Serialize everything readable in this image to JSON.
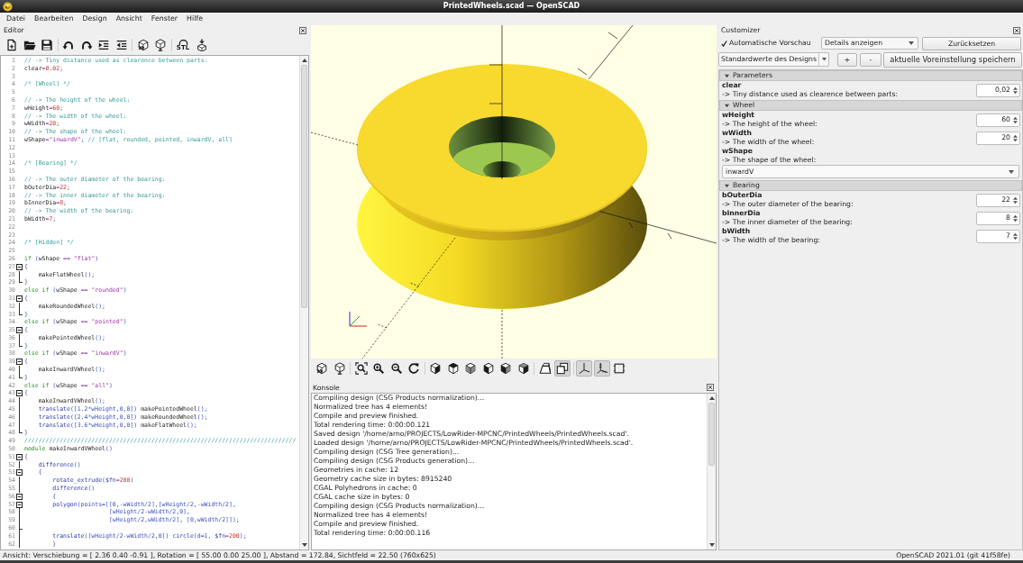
{
  "window": {
    "title": "PrintedWheels.scad — OpenSCAD"
  },
  "menu": [
    "Datei",
    "Bearbeiten",
    "Design",
    "Ansicht",
    "Fenster",
    "Hilfe"
  ],
  "editor": {
    "title": "Editor",
    "toolbar": [
      [
        {
          "kind": "new"
        },
        {
          "kind": "open"
        },
        {
          "kind": "save"
        }
      ],
      [
        {
          "kind": "undo"
        },
        {
          "kind": "redo"
        },
        {
          "kind": "indent"
        },
        {
          "kind": "unindent"
        }
      ],
      [
        {
          "kind": "preview"
        },
        {
          "kind": "render"
        }
      ],
      [
        {
          "kind": "export_stl",
          "label": "STL"
        },
        {
          "kind": "send_to_print"
        }
      ]
    ],
    "lines": [
      {
        "number": "1",
        "tokens": [
          {
            "kind": "comment",
            "text": "// -> Tiny distance used as clearence between parts:"
          }
        ]
      },
      {
        "number": "2",
        "tokens": [
          {
            "kind": "plain",
            "text": "clear"
          },
          {
            "kind": "operator",
            "text": "="
          },
          {
            "kind": "number",
            "text": "0.02"
          },
          {
            "kind": "punct",
            "text": ";"
          }
        ]
      },
      {
        "number": "3"
      },
      {
        "number": "4",
        "tokens": [
          {
            "kind": "comment",
            "text": "/* [Wheel] */"
          }
        ]
      },
      {
        "number": "5"
      },
      {
        "number": "6",
        "tokens": [
          {
            "kind": "comment",
            "text": "// -> The height of the wheel:"
          }
        ]
      },
      {
        "number": "7",
        "tokens": [
          {
            "kind": "plain",
            "text": "wHeight"
          },
          {
            "kind": "operator",
            "text": "="
          },
          {
            "kind": "number",
            "text": "60"
          },
          {
            "kind": "punct",
            "text": ";"
          }
        ]
      },
      {
        "number": "8",
        "tokens": [
          {
            "kind": "comment",
            "text": "// -> The width of the wheel:"
          }
        ]
      },
      {
        "number": "9",
        "tokens": [
          {
            "kind": "plain",
            "text": "wWidth"
          },
          {
            "kind": "operator",
            "text": "="
          },
          {
            "kind": "number",
            "text": "20"
          },
          {
            "kind": "punct",
            "text": ";"
          }
        ]
      },
      {
        "number": "10",
        "tokens": [
          {
            "kind": "comment",
            "text": "// -> The shape of the wheel:"
          }
        ]
      },
      {
        "number": "11",
        "tokens": [
          {
            "kind": "plain",
            "text": "wShape"
          },
          {
            "kind": "operator",
            "text": "="
          },
          {
            "kind": "string",
            "text": "\"inwardV\""
          },
          {
            "kind": "punct",
            "text": "; "
          },
          {
            "kind": "comment",
            "text": "// [flat, rounded, pointed, inwardV, all]"
          }
        ]
      },
      {
        "number": "12"
      },
      {
        "number": "13"
      },
      {
        "number": "14",
        "tokens": [
          {
            "kind": "comment",
            "text": "/* [Bearing] */"
          }
        ]
      },
      {
        "number": "15"
      },
      {
        "number": "16",
        "tokens": [
          {
            "kind": "comment",
            "text": "// -> The outer diameter of the bearing:"
          }
        ]
      },
      {
        "number": "17",
        "tokens": [
          {
            "kind": "plain",
            "text": "bOuterDia"
          },
          {
            "kind": "operator",
            "text": "="
          },
          {
            "kind": "number",
            "text": "22"
          },
          {
            "kind": "punct",
            "text": ";"
          }
        ]
      },
      {
        "number": "18",
        "tokens": [
          {
            "kind": "comment",
            "text": "// -> The inner diameter of the bearing:"
          }
        ]
      },
      {
        "number": "19",
        "tokens": [
          {
            "kind": "plain",
            "text": "bInnerDia"
          },
          {
            "kind": "operator",
            "text": "="
          },
          {
            "kind": "number",
            "text": "8"
          },
          {
            "kind": "punct",
            "text": ";"
          }
        ]
      },
      {
        "number": "20",
        "tokens": [
          {
            "kind": "comment",
            "text": "// -> The width of the bearing:"
          }
        ]
      },
      {
        "number": "21",
        "tokens": [
          {
            "kind": "plain",
            "text": "bWidth"
          },
          {
            "kind": "operator",
            "text": "="
          },
          {
            "kind": "number",
            "text": "7"
          },
          {
            "kind": "punct",
            "text": ";"
          }
        ]
      },
      {
        "number": "22"
      },
      {
        "number": "23"
      },
      {
        "number": "24",
        "tokens": [
          {
            "kind": "comment",
            "text": "/* [Hidden] */"
          }
        ]
      },
      {
        "number": "25"
      },
      {
        "number": "26",
        "tokens": [
          {
            "kind": "keyword",
            "text": "if "
          },
          {
            "kind": "punct",
            "text": "("
          },
          {
            "kind": "plain",
            "text": "wShape "
          },
          {
            "kind": "operator",
            "text": "== "
          },
          {
            "kind": "string",
            "text": "\"flat\""
          },
          {
            "kind": "punct",
            "text": ")"
          }
        ]
      },
      {
        "number": "27",
        "fold": {
          "kind": "open"
        },
        "tokens": [
          {
            "kind": "punct",
            "text": "{"
          }
        ]
      },
      {
        "number": "28",
        "fold": {
          "kind": "line"
        },
        "tokens": [
          {
            "kind": "plain",
            "text": "    makeFlatWheel"
          },
          {
            "kind": "punct",
            "text": "();"
          }
        ]
      },
      {
        "number": "29",
        "fold": {
          "kind": "end"
        },
        "tokens": [
          {
            "kind": "punct",
            "text": "}"
          }
        ]
      },
      {
        "number": "30",
        "tokens": [
          {
            "kind": "keyword",
            "text": "else if "
          },
          {
            "kind": "punct",
            "text": "("
          },
          {
            "kind": "plain",
            "text": "wShape "
          },
          {
            "kind": "operator",
            "text": "== "
          },
          {
            "kind": "string",
            "text": "\"rounded\""
          },
          {
            "kind": "punct",
            "text": ")"
          }
        ]
      },
      {
        "number": "31",
        "fold": {
          "kind": "open"
        },
        "tokens": [
          {
            "kind": "punct",
            "text": "{"
          }
        ]
      },
      {
        "number": "32",
        "fold": {
          "kind": "line"
        },
        "tokens": [
          {
            "kind": "plain",
            "text": "    makeRoundedWheel"
          },
          {
            "kind": "punct",
            "text": "();"
          }
        ]
      },
      {
        "number": "33",
        "fold": {
          "kind": "end"
        },
        "tokens": [
          {
            "kind": "punct",
            "text": "}"
          }
        ]
      },
      {
        "number": "34",
        "tokens": [
          {
            "kind": "keyword",
            "text": "else if "
          },
          {
            "kind": "punct",
            "text": "("
          },
          {
            "kind": "plain",
            "text": "wShape "
          },
          {
            "kind": "operator",
            "text": "== "
          },
          {
            "kind": "string",
            "text": "\"pointed\""
          },
          {
            "kind": "punct",
            "text": ")"
          }
        ]
      },
      {
        "number": "35",
        "fold": {
          "kind": "open"
        },
        "tokens": [
          {
            "kind": "punct",
            "text": "{"
          }
        ]
      },
      {
        "number": "36",
        "fold": {
          "kind": "line"
        },
        "tokens": [
          {
            "kind": "plain",
            "text": "    makePointedWheel"
          },
          {
            "kind": "punct",
            "text": "();"
          }
        ]
      },
      {
        "number": "37",
        "fold": {
          "kind": "end"
        },
        "tokens": [
          {
            "kind": "punct",
            "text": "}"
          }
        ]
      },
      {
        "number": "38",
        "tokens": [
          {
            "kind": "keyword",
            "text": "else if "
          },
          {
            "kind": "punct",
            "text": "("
          },
          {
            "kind": "plain",
            "text": "wShape "
          },
          {
            "kind": "operator",
            "text": "== "
          },
          {
            "kind": "string",
            "text": "\"inwardV\""
          },
          {
            "kind": "punct",
            "text": ")"
          }
        ]
      },
      {
        "number": "39",
        "fold": {
          "kind": "open"
        },
        "tokens": [
          {
            "kind": "punct",
            "text": "{"
          }
        ]
      },
      {
        "number": "40",
        "fold": {
          "kind": "line"
        },
        "tokens": [
          {
            "kind": "plain",
            "text": "    makeInwardVWheel"
          },
          {
            "kind": "punct",
            "text": "();"
          }
        ]
      },
      {
        "number": "41",
        "fold": {
          "kind": "end"
        },
        "tokens": [
          {
            "kind": "punct",
            "text": "}"
          }
        ]
      },
      {
        "number": "42",
        "tokens": [
          {
            "kind": "keyword",
            "text": "else if "
          },
          {
            "kind": "punct",
            "text": "("
          },
          {
            "kind": "plain",
            "text": "wShape "
          },
          {
            "kind": "operator",
            "text": "== "
          },
          {
            "kind": "string",
            "text": "\"all\""
          },
          {
            "kind": "punct",
            "text": ")"
          }
        ]
      },
      {
        "number": "43",
        "fold": {
          "kind": "open"
        },
        "tokens": [
          {
            "kind": "punct",
            "text": "{"
          }
        ]
      },
      {
        "number": "44",
        "fold": {
          "kind": "line"
        },
        "tokens": [
          {
            "kind": "plain",
            "text": "    makeInwardVWheel"
          },
          {
            "kind": "punct",
            "text": "();"
          }
        ]
      },
      {
        "number": "45",
        "fold": {
          "kind": "line"
        },
        "tokens": [
          {
            "kind": "builtin",
            "text": "    translate"
          },
          {
            "kind": "punct",
            "text": "([1.2*wHeight,0,0])"
          },
          {
            "kind": "plain",
            "text": " makePointedWheel"
          },
          {
            "kind": "punct",
            "text": "();"
          }
        ]
      },
      {
        "number": "46",
        "fold": {
          "kind": "line"
        },
        "tokens": [
          {
            "kind": "builtin",
            "text": "    translate"
          },
          {
            "kind": "punct",
            "text": "([2.4*wHeight,0,0])"
          },
          {
            "kind": "plain",
            "text": " makeRoundedWheel"
          },
          {
            "kind": "punct",
            "text": "();"
          }
        ]
      },
      {
        "number": "47",
        "fold": {
          "kind": "line"
        },
        "tokens": [
          {
            "kind": "builtin",
            "text": "    translate"
          },
          {
            "kind": "punct",
            "text": "([3.6*wHeight,0,0])"
          },
          {
            "kind": "plain",
            "text": " makeFlatWheel"
          },
          {
            "kind": "punct",
            "text": "();"
          }
        ]
      },
      {
        "number": "48",
        "fold": {
          "kind": "end"
        },
        "tokens": [
          {
            "kind": "punct",
            "text": "}"
          }
        ]
      },
      {
        "number": "49",
        "tokens": [
          {
            "kind": "comment",
            "text": "/////////////////////////////////////////////////////////////////////////////"
          }
        ]
      },
      {
        "number": "50",
        "tokens": [
          {
            "kind": "keyword",
            "text": "module "
          },
          {
            "kind": "plain",
            "text": "makeInwardVWheel"
          },
          {
            "kind": "punct",
            "text": "()"
          }
        ]
      },
      {
        "number": "51",
        "fold": {
          "kind": "open"
        },
        "tokens": [
          {
            "kind": "punct",
            "text": "{"
          }
        ]
      },
      {
        "number": "52",
        "fold": {
          "kind": "line"
        },
        "tokens": [
          {
            "kind": "builtin",
            "text": "    difference"
          },
          {
            "kind": "punct",
            "text": "()"
          }
        ]
      },
      {
        "number": "53",
        "fold": {
          "kind": "open"
        },
        "tokens": [
          {
            "kind": "punct",
            "text": "    {"
          }
        ]
      },
      {
        "number": "54",
        "fold": {
          "kind": "line"
        },
        "tokens": [
          {
            "kind": "builtin",
            "text": "        rotate_extrude"
          },
          {
            "kind": "punct",
            "text": "("
          },
          {
            "kind": "builtin",
            "text": "$fn"
          },
          {
            "kind": "operator",
            "text": "="
          },
          {
            "kind": "number",
            "text": "200"
          },
          {
            "kind": "punct",
            "text": ")"
          }
        ]
      },
      {
        "number": "55",
        "fold": {
          "kind": "line"
        },
        "tokens": [
          {
            "kind": "builtin",
            "text": "        difference"
          },
          {
            "kind": "punct",
            "text": "()"
          }
        ]
      },
      {
        "number": "56",
        "fold": {
          "kind": "open"
        },
        "tokens": [
          {
            "kind": "punct",
            "text": "        {"
          }
        ]
      },
      {
        "number": "57",
        "fold": {
          "kind": "open"
        },
        "tokens": [
          {
            "kind": "builtin",
            "text": "        polygon"
          },
          {
            "kind": "punct",
            "text": "(points=[[0,-wWidth/2],[wHeight/2,-wWidth/2],"
          }
        ]
      },
      {
        "number": "58",
        "fold": {
          "kind": "line"
        },
        "tokens": [
          {
            "kind": "punct",
            "text": "                        [wHeight/2-wWidth/2,0],"
          }
        ]
      },
      {
        "number": "59",
        "fold": {
          "kind": "line"
        },
        "tokens": [
          {
            "kind": "punct",
            "text": "                        [wHeight/2,wWidth/2], [0,wWidth/2]]);"
          }
        ]
      },
      {
        "number": "60",
        "fold": {
          "kind": "branch"
        }
      },
      {
        "number": "61",
        "fold": {
          "kind": "line"
        },
        "tokens": [
          {
            "kind": "builtin",
            "text": "        translate"
          },
          {
            "kind": "punct",
            "text": "([wHeight/2-wWidth/2,0]) "
          },
          {
            "kind": "builtin",
            "text": "circle"
          },
          {
            "kind": "punct",
            "text": "(d=1, "
          },
          {
            "kind": "builtin",
            "text": "$fn"
          },
          {
            "kind": "operator",
            "text": "="
          },
          {
            "kind": "number",
            "text": "200"
          },
          {
            "kind": "punct",
            "text": ");"
          }
        ]
      },
      {
        "number": "62",
        "fold": {
          "kind": "line"
        },
        "tokens": [
          {
            "kind": "punct",
            "text": "        }"
          }
        ]
      }
    ]
  },
  "viewport": {
    "toolbar": [
      [
        {
          "kind": "preview"
        },
        {
          "kind": "render"
        }
      ],
      [
        {
          "kind": "view_all"
        },
        {
          "kind": "zoom_in"
        },
        {
          "kind": "zoom_out"
        },
        {
          "kind": "reset_view"
        }
      ],
      [
        {
          "kind": "view_right"
        },
        {
          "kind": "view_top"
        },
        {
          "kind": "view_bottom"
        },
        {
          "kind": "view_left"
        },
        {
          "kind": "view_front"
        },
        {
          "kind": "view_back"
        }
      ],
      [
        {
          "kind": "perspective",
          "on": false
        },
        {
          "kind": "orthogonal",
          "on": true
        }
      ],
      [
        {
          "kind": "axes",
          "on": true
        },
        {
          "kind": "scale_markers",
          "on": true
        },
        {
          "kind": "edges",
          "on": false
        }
      ]
    ]
  },
  "console": {
    "title": "Konsole",
    "lines": [
      "Compiling design (CSG Products normalization)...",
      "Normalized tree has 4 elements!",
      "Compile and preview finished.",
      "Total rendering time: 0:00:00.121",
      "Saved design '/home/arno/PROJECTS/LowRider-MPCNC/PrintedWheels/PrintedWheels.scad'.",
      "Loaded design '/home/arno/PROJECTS/LowRider-MPCNC/PrintedWheels/PrintedWheels.scad'.",
      "Compiling design (CSG Tree generation)...",
      "Compiling design (CSG Products generation)...",
      "Geometries in cache: 12",
      "Geometry cache size in bytes: 8915240",
      "CGAL Polyhedrons in cache: 0",
      "CGAL cache size in bytes: 0",
      "Compiling design (CSG Products normalization)...",
      "Normalized tree has 4 elements!",
      "Compile and preview finished.",
      "Total rendering time: 0:00:00.116"
    ]
  },
  "customizer": {
    "title": "Customizer",
    "auto_preview": {
      "label": "Automatische Vorschau",
      "checked": true
    },
    "details_dropdown": "Details anzeigen",
    "reset_button": "Zurücksetzen",
    "preset_dropdown": "Standardwerte des Designs",
    "add_preset_button": "+",
    "remove_preset_button": "-",
    "save_preset_button": "aktuelle Voreinstellung speichern",
    "groups": [
      {
        "title": "Parameters",
        "expanded": true,
        "params": [
          {
            "kind": "spinbox",
            "name": "clear",
            "description": "-> Tiny distance used as clearence between parts:",
            "value": "0,02"
          }
        ]
      },
      {
        "title": "Wheel",
        "expanded": true,
        "params": [
          {
            "kind": "spinbox",
            "name": "wHeight",
            "description": "-> The height of the wheel:",
            "value": "60"
          },
          {
            "kind": "spinbox",
            "name": "wWidth",
            "description": "-> The width of the wheel:",
            "value": "20"
          },
          {
            "kind": "dropdown",
            "name": "wShape",
            "description": "-> The shape of the wheel:",
            "value": "inwardV"
          }
        ]
      },
      {
        "title": "Bearing",
        "expanded": true,
        "params": [
          {
            "kind": "spinbox",
            "name": "bOuterDia",
            "description": "-> The outer diameter of the bearing:",
            "value": "22"
          },
          {
            "kind": "spinbox",
            "name": "bInnerDia",
            "description": "-> The inner diameter of the bearing:",
            "value": "8"
          },
          {
            "kind": "spinbox",
            "name": "bWidth",
            "description": "-> The width of the bearing:",
            "value": "7"
          }
        ]
      }
    ]
  },
  "status_bar": {
    "view_info": "Ansicht: Verschiebung = [ 2.36 0.40 -0.91 ], Rotation = [ 55.00 0.00 25.00 ], Abstand = 172.84, Sichtfeld = 22.50 (760x625)",
    "version": "OpenSCAD 2021.01 (git 41f58fe)"
  }
}
